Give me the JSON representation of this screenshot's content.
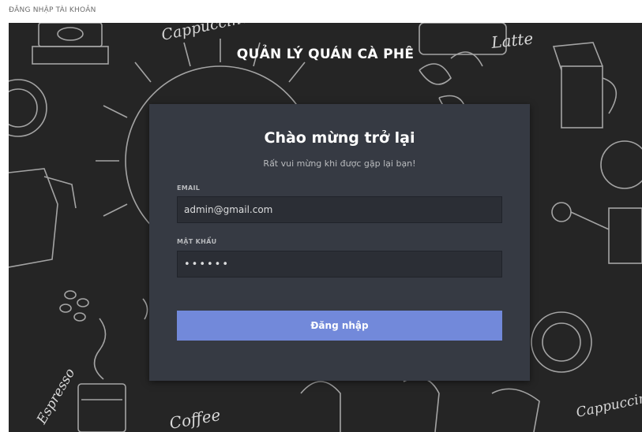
{
  "window": {
    "title": "ĐĂNG NHẬP TÀI KHOẢN"
  },
  "header": {
    "app_title": "QUẢN LÝ QUÁN CÀ PHÊ"
  },
  "background": {
    "words": [
      "Cappuccino",
      "Latte",
      "Espresso",
      "Coffee",
      "Cappuccino"
    ]
  },
  "login": {
    "heading": "Chào mừng trở lại",
    "subheading": "Rất vui mừng khi được gặp lại bạn!",
    "email_label": "EMAIL",
    "email_value": "admin@gmail.com",
    "password_label": "MẬT KHẨU",
    "password_value": "••••••",
    "submit_label": "Đăng nhập"
  },
  "colors": {
    "background": "#252525",
    "card": "#363a43",
    "input": "#2b2e35",
    "accent": "#7289da"
  }
}
